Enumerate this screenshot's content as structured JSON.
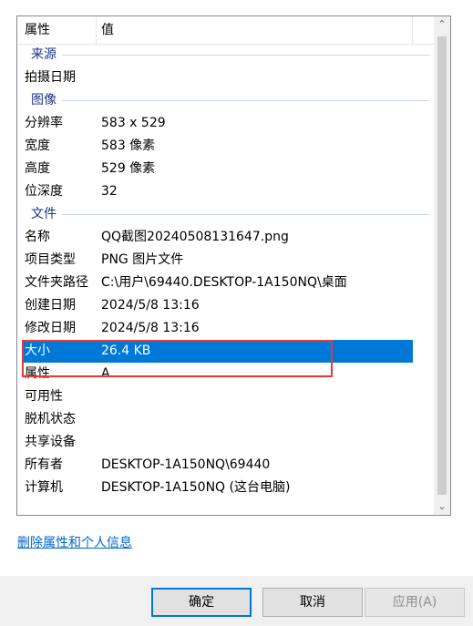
{
  "columns": {
    "name": "属性",
    "value": "值"
  },
  "groups": [
    {
      "name": "来源",
      "rows": [
        {
          "name": "拍摄日期",
          "value": ""
        }
      ]
    },
    {
      "name": "图像",
      "rows": [
        {
          "name": "分辨率",
          "value": "583 x 529"
        },
        {
          "name": "宽度",
          "value": "583 像素"
        },
        {
          "name": "高度",
          "value": "529 像素"
        },
        {
          "name": "位深度",
          "value": "32"
        }
      ]
    },
    {
      "name": "文件",
      "rows": [
        {
          "name": "名称",
          "value": "QQ截图20240508131647.png"
        },
        {
          "name": "项目类型",
          "value": "PNG 图片文件"
        },
        {
          "name": "文件夹路径",
          "value": "C:\\用户\\69440.DESKTOP-1A150NQ\\桌面"
        },
        {
          "name": "创建日期",
          "value": "2024/5/8 13:16"
        },
        {
          "name": "修改日期",
          "value": "2024/5/8 13:16"
        },
        {
          "name": "大小",
          "value": "26.4 KB"
        },
        {
          "name": "属性",
          "value": "A"
        },
        {
          "name": "可用性",
          "value": ""
        },
        {
          "name": "脱机状态",
          "value": ""
        },
        {
          "name": "共享设备",
          "value": ""
        },
        {
          "name": "所有者",
          "value": "DESKTOP-1A150NQ\\69440"
        },
        {
          "name": "计算机",
          "value": "DESKTOP-1A150NQ (这台电脑)"
        }
      ]
    }
  ],
  "selected_row": "大小",
  "scrollbar": {
    "up_icon": "chevron-up-icon",
    "down_icon": "chevron-down-icon"
  },
  "link_text": "删除属性和个人信息",
  "buttons": {
    "ok": "确定",
    "cancel": "取消",
    "apply": "应用(A)"
  },
  "colors": {
    "selection": "#0078d7",
    "highlight_border": "#e53935",
    "group_text": "#1e3287",
    "link": "#0066cc"
  }
}
